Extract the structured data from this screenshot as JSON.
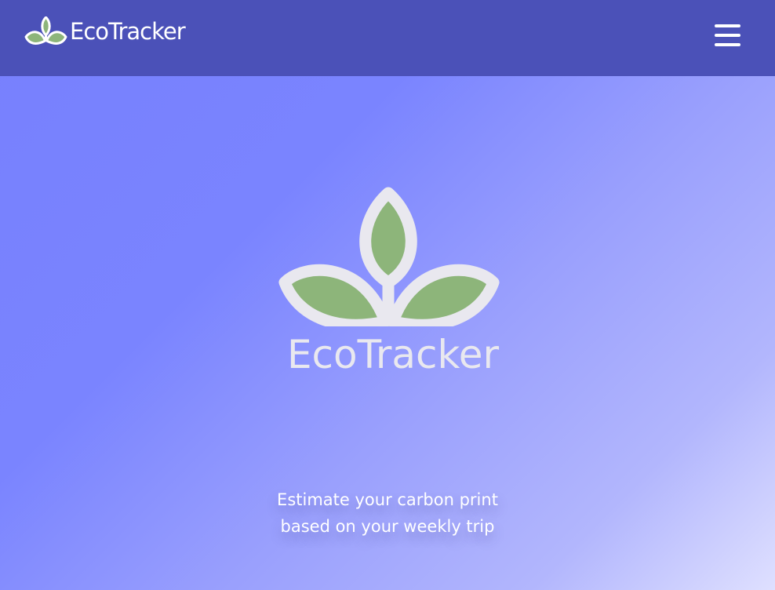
{
  "navbar": {
    "brand": "EcoTracker",
    "logo_icon": "leaves-icon",
    "menu_icon": "hamburger-menu-icon",
    "background": "#4b51b8"
  },
  "hero": {
    "logo_icon": "leaves-icon",
    "logo_text": "EcoTracker",
    "tagline_line1": "Estimate your carbon print",
    "tagline_line2": "based on your weekly trip"
  },
  "colors": {
    "leaf_fill": "#8db57a",
    "leaf_outline": "#e9e8ef",
    "gradient_start": "#7780fd",
    "gradient_end": "#dfe0ff"
  }
}
